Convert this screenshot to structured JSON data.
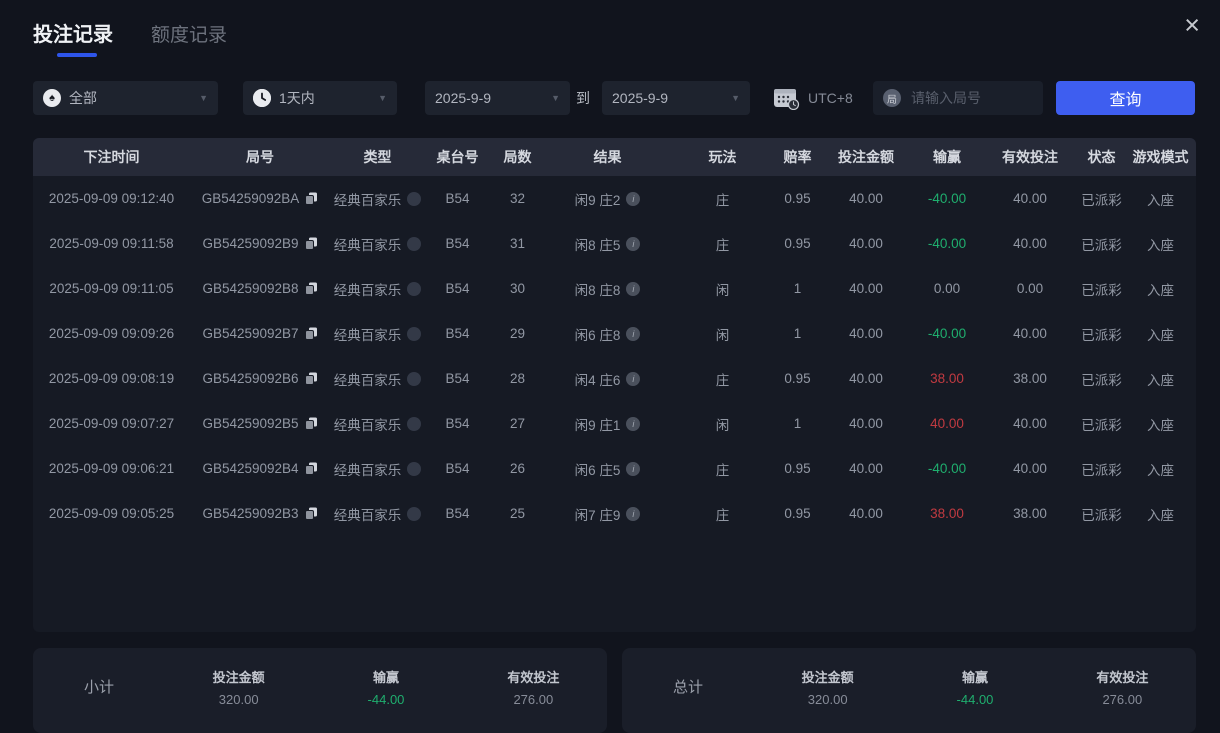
{
  "tabs": [
    {
      "label": "投注记录",
      "active": true
    },
    {
      "label": "额度记录",
      "active": false
    }
  ],
  "icons": {
    "close": "×",
    "chevron": "▼",
    "spade": "♠",
    "info": "i",
    "round_badge": "局"
  },
  "filters": {
    "game_type_value": "全部",
    "time_range_value": "1天内",
    "date_from": "2025-9-9",
    "to_label": "到",
    "date_to": "2025-9-9",
    "timezone": "UTC+8",
    "round_placeholder": "请输入局号",
    "query_button": "查询"
  },
  "table": {
    "headers": [
      "下注时间",
      "局号",
      "类型",
      "桌台号",
      "局数",
      "结果",
      "玩法",
      "赔率",
      "投注金额",
      "输赢",
      "有效投注",
      "状态",
      "游戏模式"
    ],
    "rows": [
      {
        "time": "2025-09-09 09:12:40",
        "round": "GB54259092BA",
        "type": "经典百家乐",
        "table_no": "B54",
        "round_count": "32",
        "result": "闲9 庄2",
        "play": "庄",
        "odds": "0.95",
        "amount": "40.00",
        "winloss": "-40.00",
        "winloss_class": "wl-neg",
        "valid": "40.00",
        "status": "已派彩",
        "mode": "入座"
      },
      {
        "time": "2025-09-09 09:11:58",
        "round": "GB54259092B9",
        "type": "经典百家乐",
        "table_no": "B54",
        "round_count": "31",
        "result": "闲8 庄5",
        "play": "庄",
        "odds": "0.95",
        "amount": "40.00",
        "winloss": "-40.00",
        "winloss_class": "wl-neg",
        "valid": "40.00",
        "status": "已派彩",
        "mode": "入座"
      },
      {
        "time": "2025-09-09 09:11:05",
        "round": "GB54259092B8",
        "type": "经典百家乐",
        "table_no": "B54",
        "round_count": "30",
        "result": "闲8 庄8",
        "play": "闲",
        "odds": "1",
        "amount": "40.00",
        "winloss": "0.00",
        "winloss_class": "wl-zero",
        "valid": "0.00",
        "status": "已派彩",
        "mode": "入座"
      },
      {
        "time": "2025-09-09 09:09:26",
        "round": "GB54259092B7",
        "type": "经典百家乐",
        "table_no": "B54",
        "round_count": "29",
        "result": "闲6 庄8",
        "play": "闲",
        "odds": "1",
        "amount": "40.00",
        "winloss": "-40.00",
        "winloss_class": "wl-neg",
        "valid": "40.00",
        "status": "已派彩",
        "mode": "入座"
      },
      {
        "time": "2025-09-09 09:08:19",
        "round": "GB54259092B6",
        "type": "经典百家乐",
        "table_no": "B54",
        "round_count": "28",
        "result": "闲4 庄6",
        "play": "庄",
        "odds": "0.95",
        "amount": "40.00",
        "winloss": "38.00",
        "winloss_class": "wl-pos",
        "valid": "38.00",
        "status": "已派彩",
        "mode": "入座"
      },
      {
        "time": "2025-09-09 09:07:27",
        "round": "GB54259092B5",
        "type": "经典百家乐",
        "table_no": "B54",
        "round_count": "27",
        "result": "闲9 庄1",
        "play": "闲",
        "odds": "1",
        "amount": "40.00",
        "winloss": "40.00",
        "winloss_class": "wl-pos",
        "valid": "40.00",
        "status": "已派彩",
        "mode": "入座"
      },
      {
        "time": "2025-09-09 09:06:21",
        "round": "GB54259092B4",
        "type": "经典百家乐",
        "table_no": "B54",
        "round_count": "26",
        "result": "闲6 庄5",
        "play": "庄",
        "odds": "0.95",
        "amount": "40.00",
        "winloss": "-40.00",
        "winloss_class": "wl-neg",
        "valid": "40.00",
        "status": "已派彩",
        "mode": "入座"
      },
      {
        "time": "2025-09-09 09:05:25",
        "round": "GB54259092B3",
        "type": "经典百家乐",
        "table_no": "B54",
        "round_count": "25",
        "result": "闲7 庄9",
        "play": "庄",
        "odds": "0.95",
        "amount": "40.00",
        "winloss": "38.00",
        "winloss_class": "wl-pos",
        "valid": "38.00",
        "status": "已派彩",
        "mode": "入座"
      }
    ]
  },
  "summary": {
    "subtotal": {
      "label": "小计",
      "bet_label": "投注金额",
      "bet": "320.00",
      "wl_label": "输赢",
      "wl": "-44.00",
      "valid_label": "有效投注",
      "valid": "276.00"
    },
    "total": {
      "label": "总计",
      "bet_label": "投注金额",
      "bet": "320.00",
      "wl_label": "输赢",
      "wl": "-44.00",
      "valid_label": "有效投注",
      "valid": "276.00"
    }
  },
  "colors": {
    "accent_blue": "#3e5ef0",
    "win_red": "#c13a41",
    "loss_green": "#1fae6e"
  }
}
